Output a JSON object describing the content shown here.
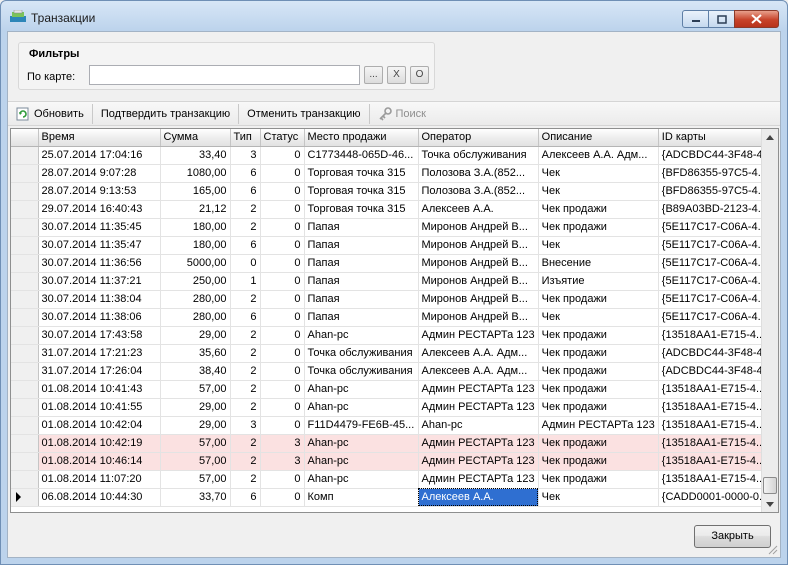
{
  "window": {
    "title": "Транзакции"
  },
  "filters": {
    "title": "Фильтры",
    "card_label": "По карте:",
    "card_value": "",
    "browse_label": "...",
    "clear_label": "X",
    "other_label": "O"
  },
  "toolbar": {
    "refresh": "Обновить",
    "confirm": "Подтвердить транзакцию",
    "cancel": "Отменить транзакцию",
    "search": "Поиск"
  },
  "grid": {
    "columns": [
      "Время",
      "Сумма",
      "Тип",
      "Статус",
      "Место продажи",
      "Оператор",
      "Описание",
      "ID карты"
    ],
    "rows": [
      {
        "time": "25.07.2014 17:04:16",
        "sum": "33,40",
        "type": "3",
        "status": "0",
        "place": "C1773448-065D-46...",
        "operator": "Точка обслуживания",
        "desc": "Алексеев А.А. Адм...",
        "card": "{ADCBDC44-3F48-4..."
      },
      {
        "time": "28.07.2014 9:07:28",
        "sum": "1080,00",
        "type": "6",
        "status": "0",
        "place": "Торговая точка 315",
        "operator": "Полозова З.А.(852...",
        "desc": "Чек",
        "card": "{BFD86355-97C5-4..."
      },
      {
        "time": "28.07.2014 9:13:53",
        "sum": "165,00",
        "type": "6",
        "status": "0",
        "place": "Торговая точка 315",
        "operator": "Полозова З.А.(852...",
        "desc": "Чек",
        "card": "{BFD86355-97C5-4..."
      },
      {
        "time": "29.07.2014 16:40:43",
        "sum": "21,12",
        "type": "2",
        "status": "0",
        "place": "Торговая точка 315",
        "operator": "Алексеев А.А.",
        "desc": "Чек продажи",
        "card": "{B89A03BD-2123-4..."
      },
      {
        "time": "30.07.2014 11:35:45",
        "sum": "180,00",
        "type": "2",
        "status": "0",
        "place": "Папая",
        "operator": "Миронов Андрей В...",
        "desc": "Чек продажи",
        "card": "{5E117C17-C06A-4..."
      },
      {
        "time": "30.07.2014 11:35:47",
        "sum": "180,00",
        "type": "6",
        "status": "0",
        "place": "Папая",
        "operator": "Миронов Андрей В...",
        "desc": "Чек",
        "card": "{5E117C17-C06A-4..."
      },
      {
        "time": "30.07.2014 11:36:56",
        "sum": "5000,00",
        "type": "0",
        "status": "0",
        "place": "Папая",
        "operator": "Миронов Андрей В...",
        "desc": "Внесение",
        "card": "{5E117C17-C06A-4..."
      },
      {
        "time": "30.07.2014 11:37:21",
        "sum": "250,00",
        "type": "1",
        "status": "0",
        "place": "Папая",
        "operator": "Миронов Андрей В...",
        "desc": "Изъятие",
        "card": "{5E117C17-C06A-4..."
      },
      {
        "time": "30.07.2014 11:38:04",
        "sum": "280,00",
        "type": "2",
        "status": "0",
        "place": "Папая",
        "operator": "Миронов Андрей В...",
        "desc": "Чек продажи",
        "card": "{5E117C17-C06A-4..."
      },
      {
        "time": "30.07.2014 11:38:06",
        "sum": "280,00",
        "type": "6",
        "status": "0",
        "place": "Папая",
        "operator": "Миронов Андрей В...",
        "desc": "Чек",
        "card": "{5E117C17-C06A-4..."
      },
      {
        "time": "30.07.2014 17:43:58",
        "sum": "29,00",
        "type": "2",
        "status": "0",
        "place": "Ahan-pc",
        "operator": "Админ РЕСТАРТа 123",
        "desc": "Чек продажи",
        "card": "{13518AA1-E715-4..."
      },
      {
        "time": "31.07.2014 17:21:23",
        "sum": "35,60",
        "type": "2",
        "status": "0",
        "place": "Точка обслуживания",
        "operator": "Алексеев А.А. Адм...",
        "desc": "Чек продажи",
        "card": "{ADCBDC44-3F48-4..."
      },
      {
        "time": "31.07.2014 17:26:04",
        "sum": "38,40",
        "type": "2",
        "status": "0",
        "place": "Точка обслуживания",
        "operator": "Алексеев А.А. Адм...",
        "desc": "Чек продажи",
        "card": "{ADCBDC44-3F48-4..."
      },
      {
        "time": "01.08.2014 10:41:43",
        "sum": "57,00",
        "type": "2",
        "status": "0",
        "place": "Ahan-pc",
        "operator": "Админ РЕСТАРТа 123",
        "desc": "Чек продажи",
        "card": "{13518AA1-E715-4..."
      },
      {
        "time": "01.08.2014 10:41:55",
        "sum": "29,00",
        "type": "2",
        "status": "0",
        "place": "Ahan-pc",
        "operator": "Админ РЕСТАРТа 123",
        "desc": "Чек продажи",
        "card": "{13518AA1-E715-4..."
      },
      {
        "time": "01.08.2014 10:42:04",
        "sum": "29,00",
        "type": "3",
        "status": "0",
        "place": "F11D4479-FE6B-45...",
        "operator": "Ahan-pc",
        "desc": "Админ РЕСТАРТа 123",
        "card": "{13518AA1-E715-4..."
      },
      {
        "time": "01.08.2014 10:42:19",
        "sum": "57,00",
        "type": "2",
        "status": "3",
        "place": "Ahan-pc",
        "operator": "Админ РЕСТАРТа 123",
        "desc": "Чек продажи",
        "card": "{13518AA1-E715-4..."
      },
      {
        "time": "01.08.2014 10:46:14",
        "sum": "57,00",
        "type": "2",
        "status": "3",
        "place": "Ahan-pc",
        "operator": "Админ РЕСТАРТа 123",
        "desc": "Чек продажи",
        "card": "{13518AA1-E715-4..."
      },
      {
        "time": "01.08.2014 11:07:20",
        "sum": "57,00",
        "type": "2",
        "status": "0",
        "place": "Ahan-pc",
        "operator": "Админ РЕСТАРТа 123",
        "desc": "Чек продажи",
        "card": "{13518AA1-E715-4..."
      },
      {
        "time": "06.08.2014 10:44:30",
        "sum": "33,70",
        "type": "6",
        "status": "0",
        "place": "Комп",
        "operator": "Алексеев А.А.",
        "desc": "Чек",
        "card": "{CADD0001-0000-0..."
      }
    ]
  },
  "colors": {
    "highlight_row": "#fbe1e1",
    "selected_cell": "#2f6fd1"
  },
  "footer": {
    "close_label": "Закрыть"
  }
}
